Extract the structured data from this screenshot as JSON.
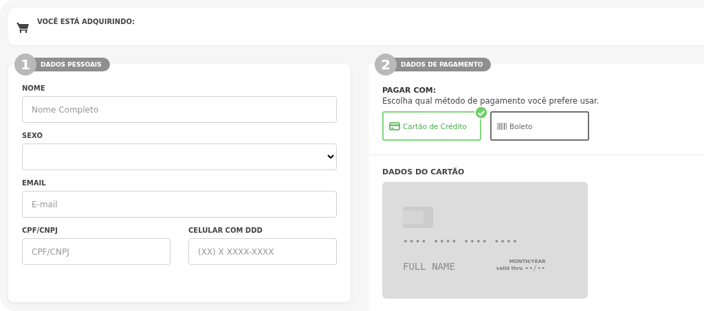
{
  "header": {
    "title": "VOCÊ ESTÁ ADQUIRINDO:"
  },
  "personal": {
    "step": "1",
    "title": "DADOS PESSOAIS",
    "rows": [
      [
        {
          "label": "NOME",
          "kind": "text",
          "placeholder": "Nome Completo"
        }
      ],
      [
        {
          "label": "SEXO",
          "kind": "select"
        }
      ],
      [
        {
          "label": "EMAIL",
          "kind": "text",
          "placeholder": "E-mail"
        }
      ],
      [
        {
          "label": "CPF/CNPJ",
          "kind": "text",
          "placeholder": "CPF/CNPJ"
        },
        {
          "label": "CELULAR COM DDD",
          "kind": "text",
          "placeholder": "(XX) X XXXX-XXXX"
        }
      ]
    ]
  },
  "payment": {
    "step": "2",
    "title": "DADOS DE PAGAMENTO",
    "heading": "PAGAR COM:",
    "description": "Escolha qual método de pagamento você prefere usar.",
    "methods": [
      {
        "kind": "card",
        "label": "Cartão de Crédito",
        "selected": true
      },
      {
        "kind": "barcode",
        "label": "Boleto",
        "selected": false
      }
    ],
    "card_title": "DADOS DO CARTÃO",
    "card": {
      "number": "•••• •••• •••• ••••",
      "name": "FULL NAME",
      "expiry_caption": "MONTH/YEAR",
      "valid_label": "valid thru",
      "expiry": "••/••"
    }
  }
}
